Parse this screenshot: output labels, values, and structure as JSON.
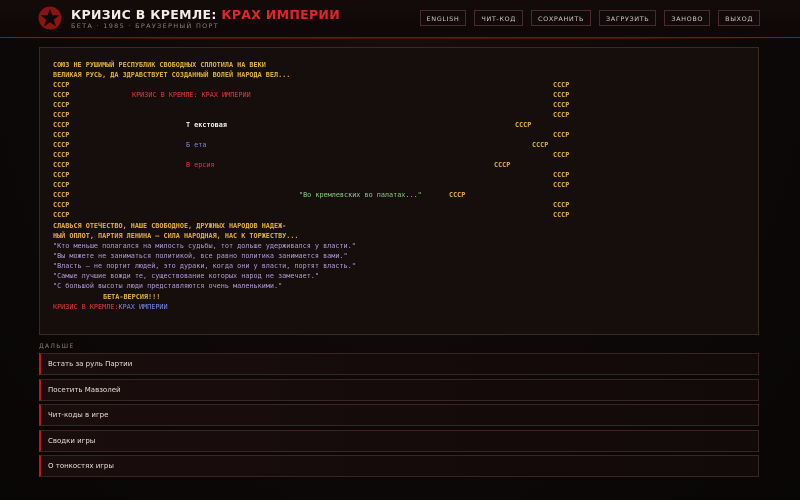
{
  "header": {
    "title_main": "КРИЗИС В КРЕМЛЕ:",
    "title_accent": "КРАХ ИМПЕРИИ",
    "subtitle": "БЕТА · 1985 · БРАУЗЕРНЫЙ ПОРТ",
    "logo_icon": "red-star-icon"
  },
  "nav": [
    {
      "label": "ENGLISH"
    },
    {
      "label": "ЧИТ-КОД"
    },
    {
      "label": "СОХРАНИТЬ"
    },
    {
      "label": "ЗАГРУЗИТЬ"
    },
    {
      "label": "ЗАНОВО"
    },
    {
      "label": "ВЫХОД"
    }
  ],
  "screen": {
    "anthem_1": "СОЮЗ НЕ РУШИМЫЙ РЕСПУБЛИК СВОБОДНЫХ СПЛОТИЛА НА ВЕКИ",
    "anthem_2": "ВЕЛИКАЯ РУСЬ, ДА ЗДРАВСТВУЕТ СОЗДАННЫЙ ВОЛЕЙ НАРОДА ВЕЛ...",
    "ussr": "СССР",
    "inner_title": "КРИЗИС В КРЕМЛЕ: КРАХ ИМПЕРИИ",
    "word_text": "Т екстовая",
    "word_beta": "Б ета",
    "word_version": "В ерсия",
    "quote_halls": "\"Во кремлевских во палатах...\"",
    "anthem_3": "СЛАВЬСЯ ОТЕЧЕСТВО, НАШЕ СВОБОДНОЕ, ДРУЖНЫХ НАРОДОВ НАДЕЖ-",
    "anthem_4": "НЫЙ ОПЛОТ, ПАРТИЯ ЛЕНИНА — СИЛА НАРОДНАЯ, НАС К ТОРЖЕСТВУ...",
    "quote_1": "\"Кто меньше полагался на милость судьбы, тот дольше удерживался у власти.\"",
    "quote_2": "\"Вы можете не заниматься политикой, все равно политика занимается вами.\"",
    "quote_3": "\"Власть — не портит людей, это дураки, когда они у власти, портят власть.\"",
    "quote_4": "\"Самые лучшие вожди те, существование которых народ не замечает.\"",
    "quote_5": "\"С большой высоты люди представляются очень маленькими.\"",
    "beta_version": "БЕТА-ВЕРСИЯ!!!",
    "footer_red": "КРИЗИС В КРЕМЛЕ:",
    "footer_blue": "КРАХ ИМПЕРИИ"
  },
  "section_label": "ДАЛЬШЕ",
  "menu": [
    {
      "label": "Встать за руль Партии"
    },
    {
      "label": "Посетить Мавзолей"
    },
    {
      "label": "Чит-коды в игре"
    },
    {
      "label": "Сводки игры"
    },
    {
      "label": "О тонкостях игры"
    }
  ]
}
